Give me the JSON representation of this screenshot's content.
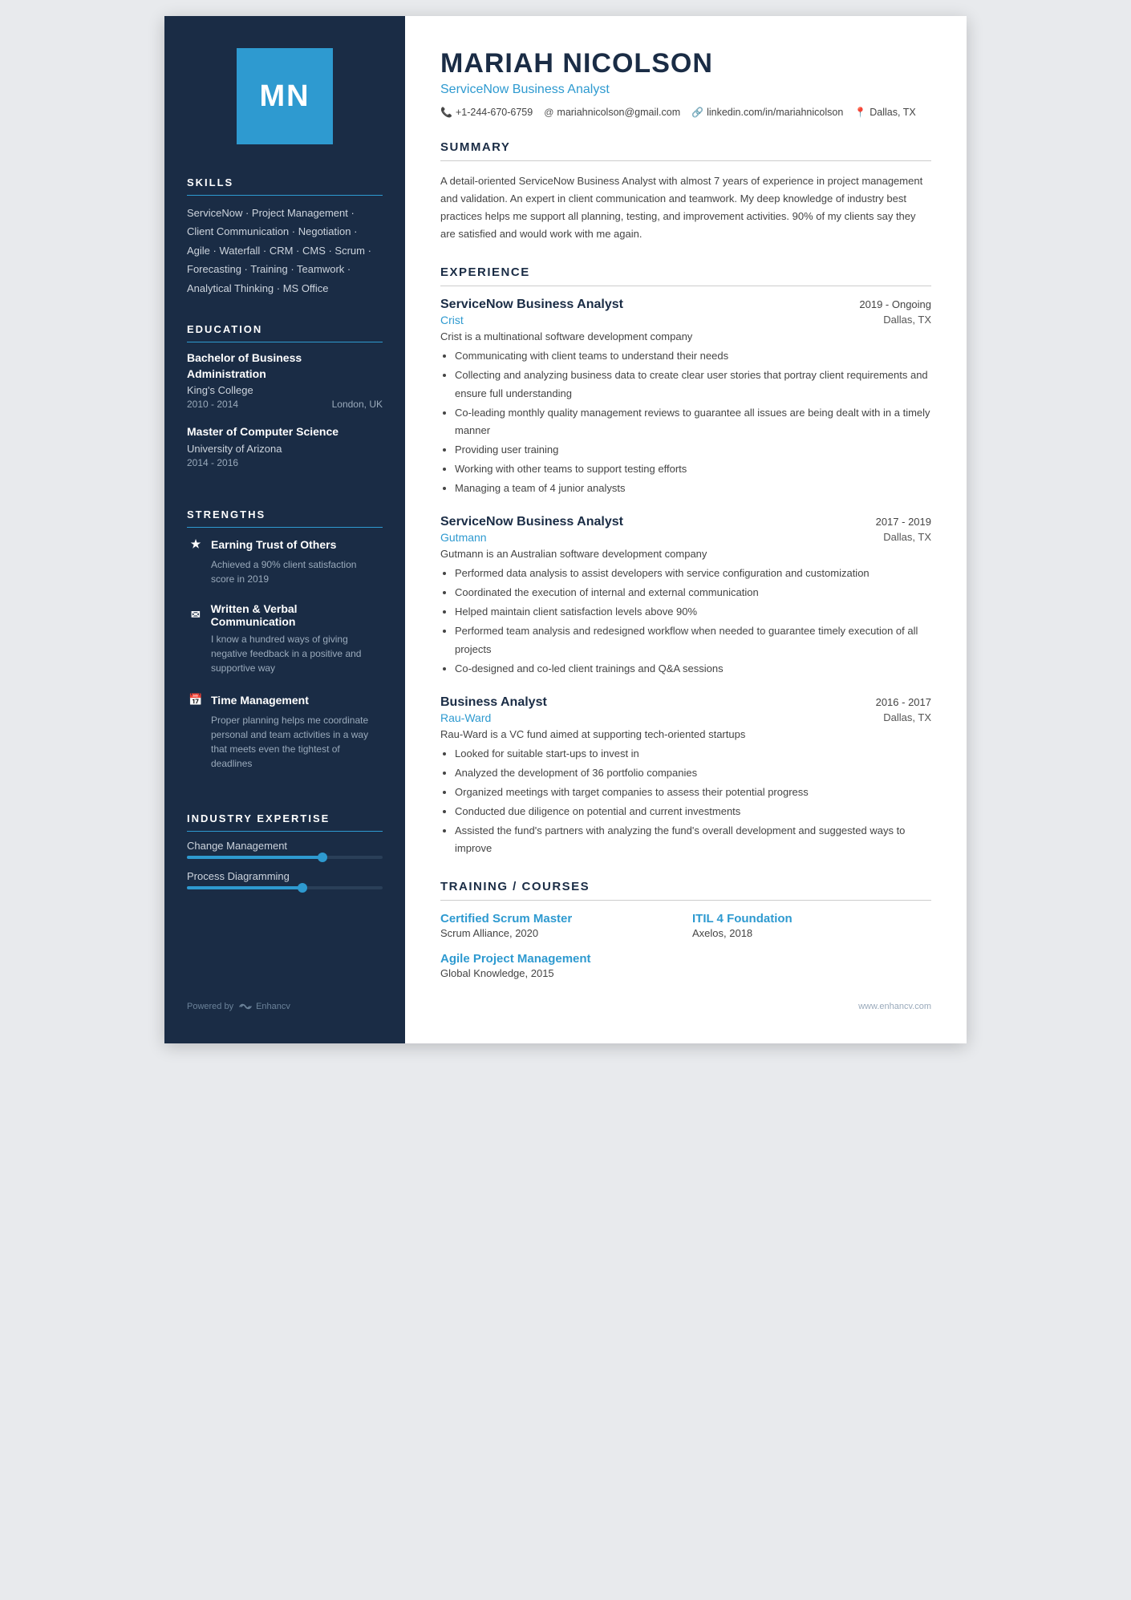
{
  "sidebar": {
    "avatar_initials": "MN",
    "sections": {
      "skills": {
        "title": "SKILLS",
        "text": "ServiceNow · Project Management · Client Communication · Negotiation · Agile · Waterfall · CRM · CMS · Scrum · Forecasting · Training · Teamwork · Analytical Thinking · MS Office"
      },
      "education": {
        "title": "EDUCATION",
        "items": [
          {
            "degree": "Bachelor of Business Administration",
            "school": "King's College",
            "years": "2010 - 2014",
            "location": "London, UK"
          },
          {
            "degree": "Master of Computer Science",
            "school": "University of Arizona",
            "years": "2014 - 2016",
            "location": ""
          }
        ]
      },
      "strengths": {
        "title": "STRENGTHS",
        "items": [
          {
            "icon": "★",
            "title": "Earning Trust of Others",
            "desc": "Achieved a 90% client satisfaction score in 2019"
          },
          {
            "icon": "✉",
            "title": "Written & Verbal Communication",
            "desc": "I know a hundred ways of giving negative feedback in a positive and supportive way"
          },
          {
            "icon": "📅",
            "title": "Time Management",
            "desc": "Proper planning helps me coordinate personal and team activities in a way that meets even the tightest of deadlines"
          }
        ]
      },
      "expertise": {
        "title": "INDUSTRY EXPERTISE",
        "items": [
          {
            "label": "Change Management",
            "percent": 70
          },
          {
            "label": "Process Diagramming",
            "percent": 60
          }
        ]
      }
    },
    "footer": {
      "powered_by": "Powered by",
      "brand": "Enhancv"
    }
  },
  "main": {
    "name": "MARIAH NICOLSON",
    "title": "ServiceNow Business Analyst",
    "contact": {
      "phone": "+1-244-670-6759",
      "email": "mariahnicolson@gmail.com",
      "linkedin": "linkedin.com/in/mariahnicolson",
      "location": "Dallas, TX"
    },
    "sections": {
      "summary": {
        "title": "SUMMARY",
        "text": "A detail-oriented ServiceNow Business Analyst with almost 7 years of experience in project management and validation. An expert in client communication and teamwork. My deep knowledge of industry best practices helps me support all planning, testing, and improvement activities. 90% of my clients say they are satisfied and would work with me again."
      },
      "experience": {
        "title": "EXPERIENCE",
        "items": [
          {
            "role": "ServiceNow Business Analyst",
            "dates": "2019 - Ongoing",
            "company": "Crist",
            "location": "Dallas, TX",
            "description": "Crist is a multinational software development company",
            "bullets": [
              "Communicating with client teams to understand their needs",
              "Collecting and analyzing business data to create clear user stories that portray client requirements and ensure full understanding",
              "Co-leading monthly quality management reviews to guarantee all issues are being dealt with in a timely manner",
              "Providing user training",
              "Working with other teams to support testing efforts",
              "Managing a team of 4 junior analysts"
            ]
          },
          {
            "role": "ServiceNow Business Analyst",
            "dates": "2017 - 2019",
            "company": "Gutmann",
            "location": "Dallas, TX",
            "description": "Gutmann is an Australian software development company",
            "bullets": [
              "Performed data analysis to assist developers with service configuration and customization",
              "Coordinated the execution of internal and external communication",
              "Helped maintain client satisfaction levels above 90%",
              "Performed team analysis and redesigned workflow when needed to guarantee timely execution of all projects",
              "Co-designed and co-led client trainings and Q&A sessions"
            ]
          },
          {
            "role": "Business Analyst",
            "dates": "2016 - 2017",
            "company": "Rau-Ward",
            "location": "Dallas, TX",
            "description": "Rau-Ward is a VC fund aimed at supporting tech-oriented startups",
            "bullets": [
              "Looked for suitable start-ups to invest in",
              "Analyzed the development of 36 portfolio companies",
              "Organized meetings with target companies to assess their potential progress",
              "Conducted due diligence on potential and current investments",
              "Assisted the fund's partners with analyzing the fund's overall development and suggested ways to improve"
            ]
          }
        ]
      },
      "training": {
        "title": "TRAINING / COURSES",
        "items": [
          {
            "name": "Certified Scrum Master",
            "sub": "Scrum Alliance, 2020"
          },
          {
            "name": "ITIL 4 Foundation",
            "sub": "Axelos, 2018"
          },
          {
            "name": "Agile Project Management",
            "sub": "Global Knowledge, 2015"
          }
        ]
      }
    },
    "footer": "www.enhancv.com"
  }
}
